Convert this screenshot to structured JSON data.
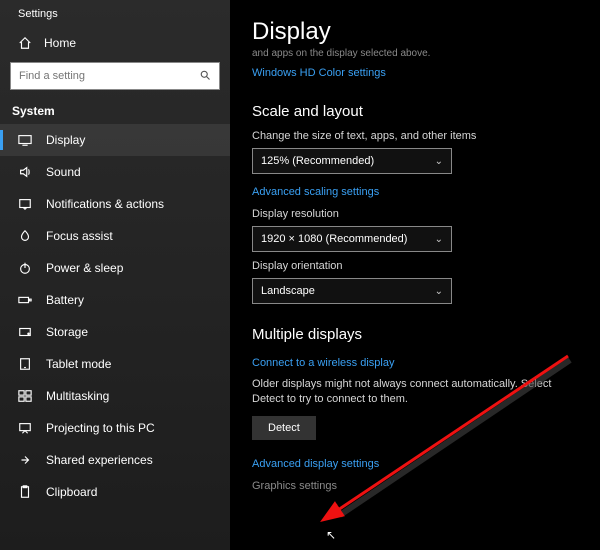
{
  "window": {
    "title": "Settings"
  },
  "sidebar": {
    "home": "Home",
    "search_placeholder": "Find a setting",
    "section": "System",
    "items": [
      {
        "label": "Display"
      },
      {
        "label": "Sound"
      },
      {
        "label": "Notifications & actions"
      },
      {
        "label": "Focus assist"
      },
      {
        "label": "Power & sleep"
      },
      {
        "label": "Battery"
      },
      {
        "label": "Storage"
      },
      {
        "label": "Tablet mode"
      },
      {
        "label": "Multitasking"
      },
      {
        "label": "Projecting to this PC"
      },
      {
        "label": "Shared experiences"
      },
      {
        "label": "Clipboard"
      }
    ]
  },
  "main": {
    "heading": "Display",
    "subtext": "and apps on the display selected above.",
    "hd_link": "Windows HD Color settings",
    "scale": {
      "heading": "Scale and layout",
      "size_label": "Change the size of text, apps, and other items",
      "size_value": "125% (Recommended)",
      "adv_link": "Advanced scaling settings",
      "res_label": "Display resolution",
      "res_value": "1920 × 1080 (Recommended)",
      "orient_label": "Display orientation",
      "orient_value": "Landscape"
    },
    "multi": {
      "heading": "Multiple displays",
      "connect_link": "Connect to a wireless display",
      "note": "Older displays might not always connect automatically. Select Detect to try to connect to them.",
      "detect": "Detect",
      "adv_link": "Advanced display settings",
      "graphics_link": "Graphics settings"
    }
  }
}
